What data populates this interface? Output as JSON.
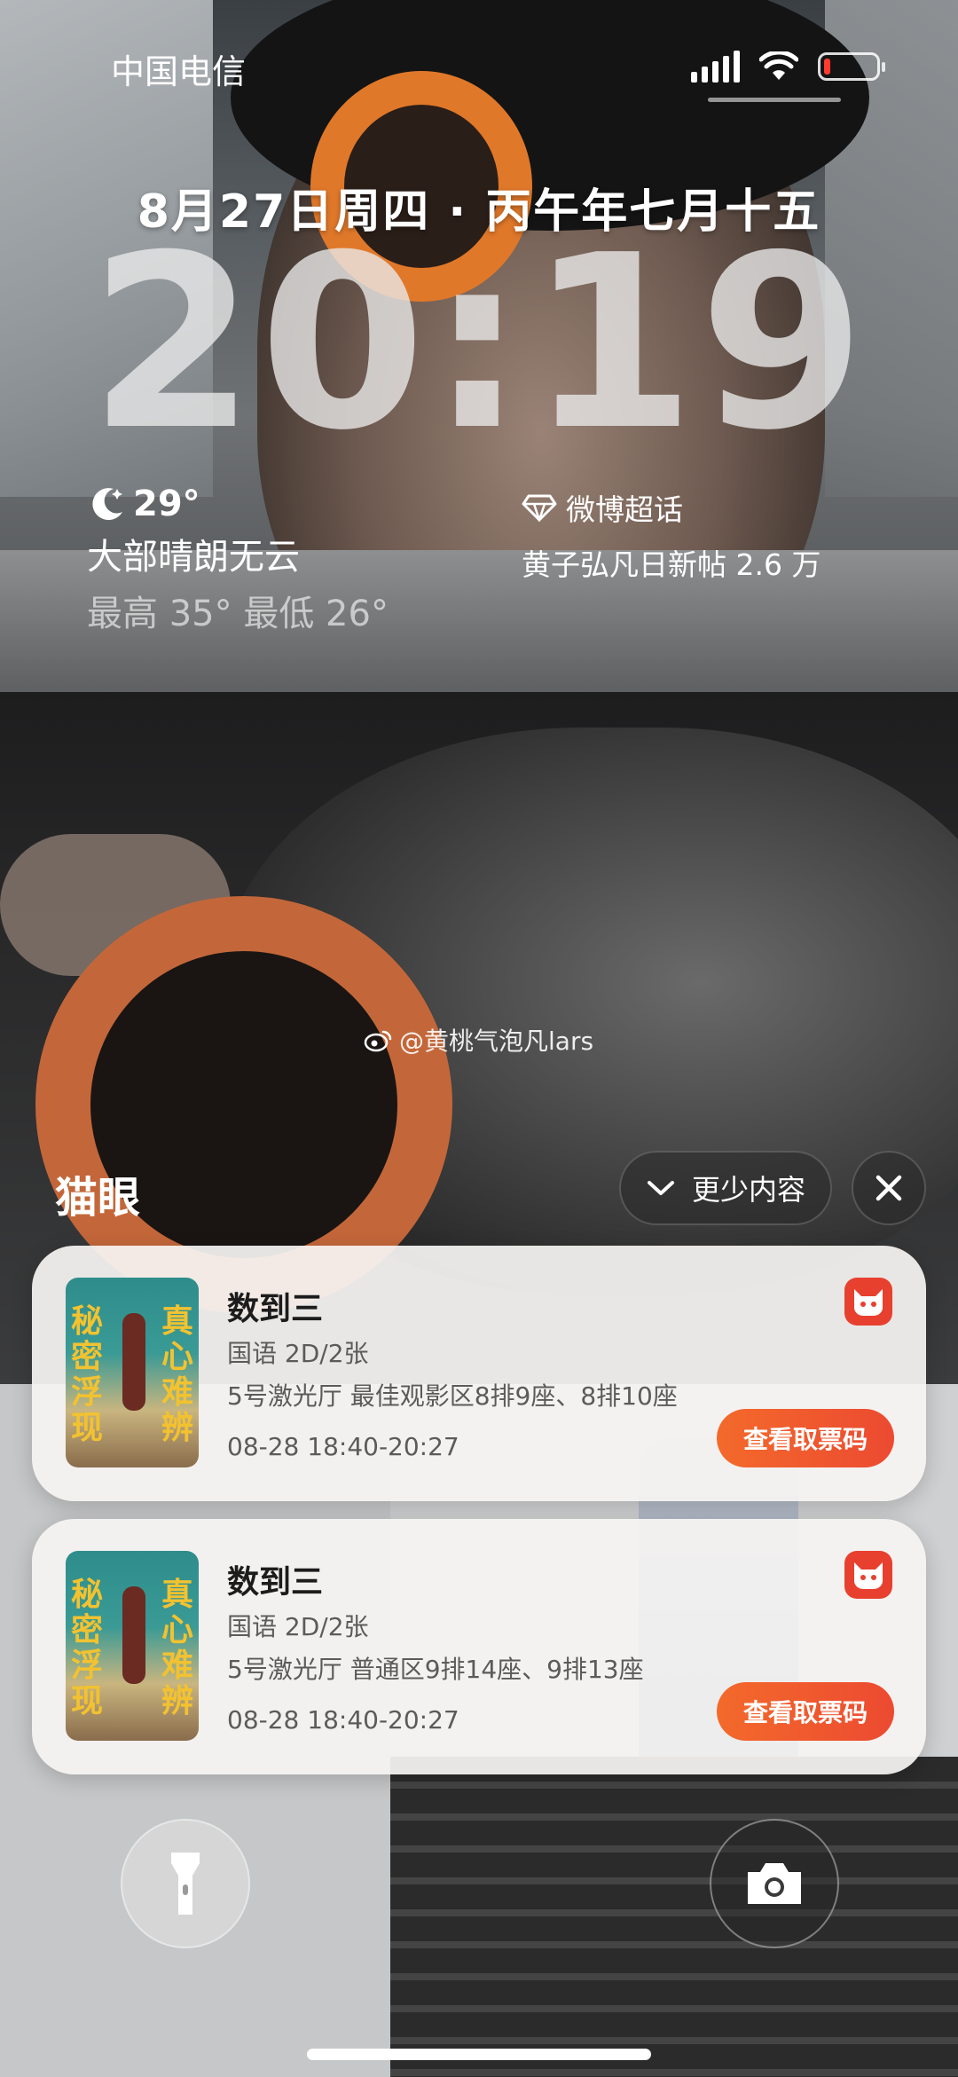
{
  "status_bar": {
    "carrier": "中国电信",
    "battery_level": 0.12,
    "icons": [
      "signal-icon",
      "wifi-icon",
      "battery-icon"
    ]
  },
  "lockscreen": {
    "date": "8月27日周四 · 丙午年七月十五",
    "time": "20:19"
  },
  "weather": {
    "temp": "29°",
    "condition": "大部晴朗无云",
    "range": "最高 35° 最低 26°",
    "icon": "moon-stars-icon"
  },
  "weibo": {
    "app": "微博超话",
    "post": "黄子弘凡日新帖 2.6 万",
    "icon": "diamond-icon"
  },
  "credit": "@黄桃气泡凡lars",
  "notifications": {
    "group": "猫眼",
    "less_label": "更少内容",
    "items": [
      {
        "poster_text_left": "秘密浮现",
        "poster_text_right": "真心难辨",
        "title": "数到三",
        "format": "国语 2D/2张",
        "seats": "5号激光厅  最佳观影区8排9座、8排10座",
        "time": "08-28 18:40-20:27",
        "button": "查看取票码"
      },
      {
        "poster_text_left": "秘密浮现",
        "poster_text_right": "真心难辨",
        "title": "数到三",
        "format": "国语 2D/2张",
        "seats": "5号激光厅  普通区9排14座、9排13座",
        "time": "08-28 18:40-20:27",
        "button": "查看取票码"
      }
    ]
  },
  "colors": {
    "accent": "#ef5a2f",
    "maoyan_red": "#e8402f"
  }
}
